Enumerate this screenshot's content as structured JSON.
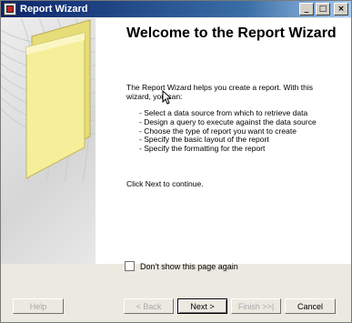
{
  "window": {
    "title": "Report Wizard",
    "controls": {
      "minimize": "_",
      "maximize": "□",
      "close": "×"
    }
  },
  "main": {
    "heading": "Welcome to the Report Wizard",
    "intro": "The Report Wizard helps you create a report. With this wizard, you can:",
    "bullets": [
      "- Select a data source from which to retrieve data",
      "- Design a query to execute against the data source",
      "- Choose the type of report you want to create",
      "- Specify the basic layout of the report",
      "- Specify the formatting for the report"
    ],
    "continue_text": "Click Next to continue."
  },
  "options": {
    "dont_show_label": "Don't show this page again",
    "dont_show_checked": false
  },
  "buttons": {
    "help": "Help",
    "back": "< Back",
    "next": "Next >",
    "finish": "Finish >>|",
    "cancel": "Cancel"
  },
  "colors": {
    "titlebar_start": "#0a246a",
    "titlebar_end": "#a6caf0",
    "folder_yellow": "#f5ef9a"
  },
  "icons": {
    "app": "report-wizard-icon",
    "decoration": "yellow-folder-graphic",
    "pointer": "mouse-pointer-icon"
  }
}
